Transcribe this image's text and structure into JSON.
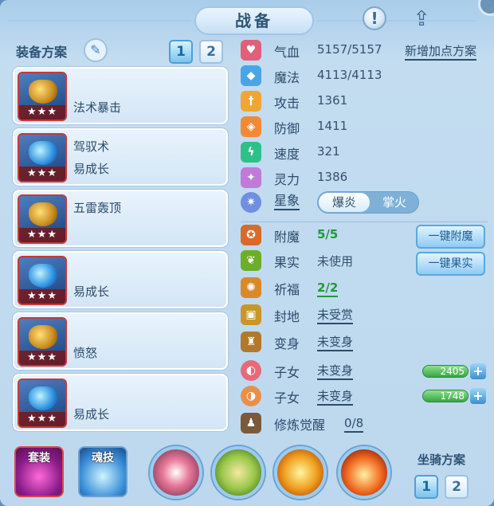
{
  "header": {
    "title": "战备"
  },
  "equip": {
    "title": "装备方案",
    "plan_buttons": [
      "1",
      "2"
    ],
    "slots": [
      {
        "line1": "",
        "line2": "法术暴击",
        "stars": "★★★"
      },
      {
        "line1": "驾驭术",
        "line2": "易成长",
        "stars": "★★★"
      },
      {
        "line1": "五雷轰顶",
        "line2": "",
        "stars": "★★★"
      },
      {
        "line1": "",
        "line2": "易成长",
        "stars": "★★★"
      },
      {
        "line1": "",
        "line2": "愤怒",
        "stars": "★★★"
      },
      {
        "line1": "",
        "line2": "易成长",
        "stars": "★★★"
      }
    ]
  },
  "stats": {
    "add_plan_link": "新增加点方案",
    "rows": [
      {
        "label": "气血",
        "value": "5157/5157",
        "icon": "heart-icon",
        "color": "#e0607a"
      },
      {
        "label": "魔法",
        "value": "4113/4113",
        "icon": "mana-icon",
        "color": "#4aa5e8"
      },
      {
        "label": "攻击",
        "value": "1361",
        "icon": "sword-icon",
        "color": "#f0a630"
      },
      {
        "label": "防御",
        "value": "1411",
        "icon": "shield-icon",
        "color": "#f08a3a"
      },
      {
        "label": "速度",
        "value": "321",
        "icon": "lightning-icon",
        "color": "#2fc08a"
      },
      {
        "label": "灵力",
        "value": "1386",
        "icon": "spirit-icon",
        "color": "#c07ad8"
      }
    ],
    "star": {
      "label": "星象",
      "opt1": "爆炎",
      "opt2": "掌火"
    }
  },
  "extras": {
    "rows": [
      {
        "label": "附魔",
        "value": "5/5",
        "icon": "enchant-icon"
      },
      {
        "label": "果实",
        "value": "未使用",
        "icon": "fruit-icon"
      },
      {
        "label": "祈福",
        "value": "2/2",
        "icon": "blessing-icon"
      },
      {
        "label": "封地",
        "value": "未受赏",
        "icon": "fief-icon"
      },
      {
        "label": "变身",
        "value": "未变身",
        "icon": "transform-icon"
      },
      {
        "label": "子女",
        "value": "未变身",
        "icon": "child-icon"
      },
      {
        "label": "子女",
        "value": "未变身",
        "icon": "child-icon"
      },
      {
        "label": "修炼觉醒",
        "value": "0/8",
        "icon": "cultivation-icon"
      }
    ],
    "enchant_button": "一键附魔",
    "fruit_button": "一键果实",
    "child_bar_1": "2405",
    "child_bar_2": "1748",
    "plus": "+"
  },
  "bottom": {
    "tag_set": "套装",
    "tag_soul": "魂技",
    "mount_title": "坐骑方案",
    "mount_buttons": [
      "1",
      "2"
    ]
  }
}
